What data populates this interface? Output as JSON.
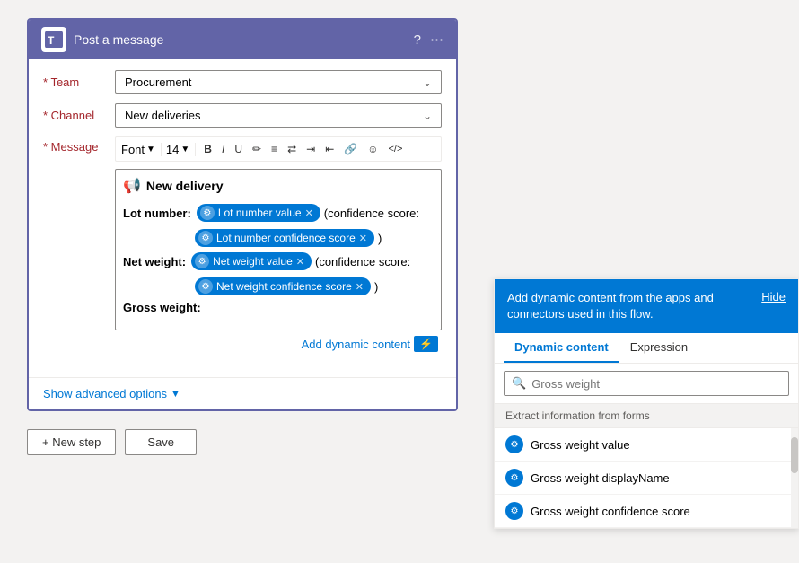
{
  "header": {
    "title": "Post a message",
    "help_icon": "?",
    "more_icon": "..."
  },
  "fields": {
    "team_label": "Team",
    "team_value": "Procurement",
    "channel_label": "Channel",
    "channel_value": "New deliveries",
    "message_label": "Message"
  },
  "toolbar": {
    "font_label": "Font",
    "font_size": "14",
    "bold": "B",
    "italic": "I",
    "underline": "U"
  },
  "message_content": {
    "heading": "New delivery",
    "lot_number_label": "Lot number:",
    "lot_number_token": "Lot number value",
    "lot_confidence_prefix": "(confidence score:",
    "lot_confidence_token": "Lot number confidence score",
    "lot_confidence_suffix": ")",
    "net_weight_label": "Net weight:",
    "net_weight_token": "Net weight value",
    "net_confidence_prefix": "(confidence score:",
    "net_confidence_token": "Net weight confidence score",
    "net_confidence_suffix": ")",
    "gross_weight_label": "Gross weight:"
  },
  "add_dynamic": {
    "link_text": "Add dynamic content",
    "btn_text": "⚡"
  },
  "show_advanced": "Show advanced options",
  "bottom_actions": {
    "new_step_label": "+ New step",
    "save_label": "Save"
  },
  "dynamic_panel": {
    "header_text": "Add dynamic content from the apps and connectors used in this flow.",
    "hide_label": "Hide",
    "tab_dynamic": "Dynamic content",
    "tab_expression": "Expression",
    "search_placeholder": "Gross weight",
    "section_label": "Extract information from forms",
    "items": [
      {
        "label": "Gross weight value"
      },
      {
        "label": "Gross weight displayName"
      },
      {
        "label": "Gross weight confidence score"
      }
    ]
  }
}
